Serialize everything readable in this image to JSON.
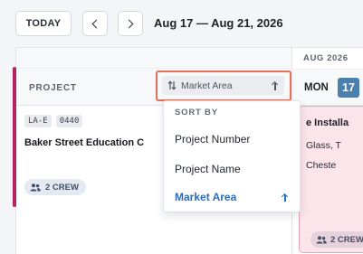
{
  "toolbar": {
    "today_label": "TODAY",
    "prev_icon": "chevron-left-icon",
    "next_icon": "chevron-right-icon",
    "date_range": "Aug 17 — Aug 21, 2026"
  },
  "grid": {
    "project_column_label": "PROJECT",
    "month_label": "AUG 2026",
    "day_name": "MON",
    "day_number": "17",
    "today_color": "#4a7fae"
  },
  "sort": {
    "current_label": "Market Area",
    "sort_icon": "sort-arrows-icon",
    "direction_icon": "arrow-up-icon",
    "highlight_color": "#e2705a",
    "menu_heading": "SORT BY",
    "options": [
      {
        "label": "Project Number",
        "selected": false
      },
      {
        "label": "Project Name",
        "selected": false
      },
      {
        "label": "Market Area",
        "selected": true
      }
    ]
  },
  "project": {
    "code_prefix": "LA-E",
    "code_number": "0440",
    "name": "Baker Street Education C",
    "crew_label": "2 CREW",
    "accent_color": "#b52460"
  },
  "event": {
    "title": "e Installa",
    "line1": "Glass, T",
    "line2": "Cheste",
    "crew_label": "2 CREW"
  }
}
